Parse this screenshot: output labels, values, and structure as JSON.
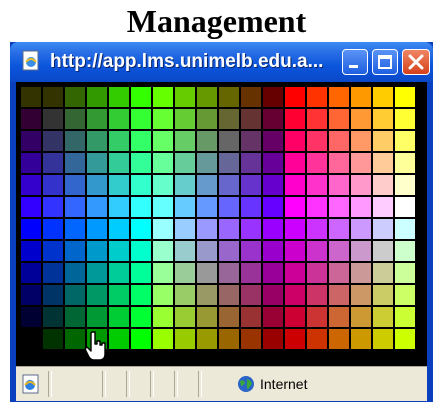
{
  "page": {
    "heading": "Management"
  },
  "window": {
    "title": "http://app.lms.unimelb.edu.a...",
    "icon": "ie-page-icon",
    "buttons": [
      "minimize-button",
      "maximize-button",
      "close-button"
    ],
    "status_zone": "Internet"
  },
  "palette": {
    "columns": 18,
    "rows": 12,
    "colors": [
      [
        "#333300",
        "#333300",
        "#336600",
        "#339900",
        "#33cc00",
        "#33ff00",
        "#66ff00",
        "#66cc00",
        "#669900",
        "#666600",
        "#663300",
        "#660000",
        "#ff0000",
        "#ff3300",
        "#ff6600",
        "#ff9900",
        "#ffcc00",
        "#ffff00"
      ],
      [
        "#330033",
        "#333333",
        "#336633",
        "#339933",
        "#33cc33",
        "#33ff33",
        "#66ff33",
        "#66cc33",
        "#669933",
        "#666633",
        "#663333",
        "#660033",
        "#ff0033",
        "#ff3333",
        "#ff6633",
        "#ff9933",
        "#ffcc33",
        "#ffff33"
      ],
      [
        "#330066",
        "#333366",
        "#336666",
        "#339966",
        "#33cc66",
        "#33ff66",
        "#66ff66",
        "#66cc66",
        "#669966",
        "#666666",
        "#663366",
        "#660066",
        "#ff0066",
        "#ff3366",
        "#ff6666",
        "#ff9966",
        "#ffcc66",
        "#ffff66"
      ],
      [
        "#330099",
        "#333399",
        "#336699",
        "#339999",
        "#33cc99",
        "#33ff99",
        "#66ff99",
        "#66cc99",
        "#669999",
        "#666699",
        "#663399",
        "#660099",
        "#ff0099",
        "#ff3399",
        "#ff6699",
        "#ff9999",
        "#ffcc99",
        "#ffff99"
      ],
      [
        "#3300cc",
        "#3333cc",
        "#3366cc",
        "#3399cc",
        "#33cccc",
        "#33ffcc",
        "#66ffcc",
        "#66cccc",
        "#6699cc",
        "#6666cc",
        "#6633cc",
        "#6600cc",
        "#ff00cc",
        "#ff33cc",
        "#ff66cc",
        "#ff99cc",
        "#ffcccc",
        "#ffffcc"
      ],
      [
        "#3300ff",
        "#3333ff",
        "#3366ff",
        "#3399ff",
        "#33ccff",
        "#33ffff",
        "#66ffff",
        "#66ccff",
        "#6699ff",
        "#6666ff",
        "#6633ff",
        "#6600ff",
        "#ff00ff",
        "#ff33ff",
        "#ff66ff",
        "#ff99ff",
        "#ffccff",
        "#ffffff"
      ],
      [
        "#0000ff",
        "#0033ff",
        "#0066ff",
        "#0099ff",
        "#00ccff",
        "#00ffff",
        "#99ffff",
        "#99ccff",
        "#9999ff",
        "#9966ff",
        "#9933ff",
        "#9900ff",
        "#cc00ff",
        "#cc33ff",
        "#cc66ff",
        "#cc99ff",
        "#ccccff",
        "#ccffff"
      ],
      [
        "#0000cc",
        "#0033cc",
        "#0066cc",
        "#0099cc",
        "#00cccc",
        "#00ffcc",
        "#99ffcc",
        "#99cccc",
        "#9999cc",
        "#9966cc",
        "#9933cc",
        "#9900cc",
        "#cc00cc",
        "#cc33cc",
        "#cc66cc",
        "#cc99cc",
        "#cccccc",
        "#ccffcc"
      ],
      [
        "#000099",
        "#003399",
        "#006699",
        "#009999",
        "#00cc99",
        "#00ff99",
        "#99ff99",
        "#99cc99",
        "#999999",
        "#996699",
        "#993399",
        "#990099",
        "#cc0099",
        "#cc3399",
        "#cc6699",
        "#cc9999",
        "#cccc99",
        "#ccff99"
      ],
      [
        "#000066",
        "#003366",
        "#006666",
        "#009966",
        "#00cc66",
        "#00ff66",
        "#99ff66",
        "#99cc66",
        "#999966",
        "#996666",
        "#993366",
        "#990066",
        "#cc0066",
        "#cc3366",
        "#cc6666",
        "#cc9966",
        "#cccc66",
        "#ccff66"
      ],
      [
        "#000033",
        "#003333",
        "#006633",
        "#009933",
        "#00cc33",
        "#00ff33",
        "#99ff33",
        "#99cc33",
        "#999933",
        "#996633",
        "#993333",
        "#990033",
        "#cc0033",
        "#cc3333",
        "#cc6633",
        "#cc9933",
        "#cccc33",
        "#ccff33"
      ],
      [
        "#000000",
        "#003300",
        "#006600",
        "#009900",
        "#00cc00",
        "#00ff00",
        "#99ff00",
        "#99cc00",
        "#999900",
        "#996600",
        "#993300",
        "#990000",
        "#cc0000",
        "#cc3300",
        "#cc6600",
        "#cc9900",
        "#cccc00",
        "#ccff00"
      ]
    ]
  },
  "cursor": {
    "icon": "hand-pointer-icon"
  },
  "colors": {
    "titlebar": "#0b55dc",
    "frame": "#0a3fbd",
    "statusbar": "#ece9d8",
    "close_button": "#d6411b"
  }
}
